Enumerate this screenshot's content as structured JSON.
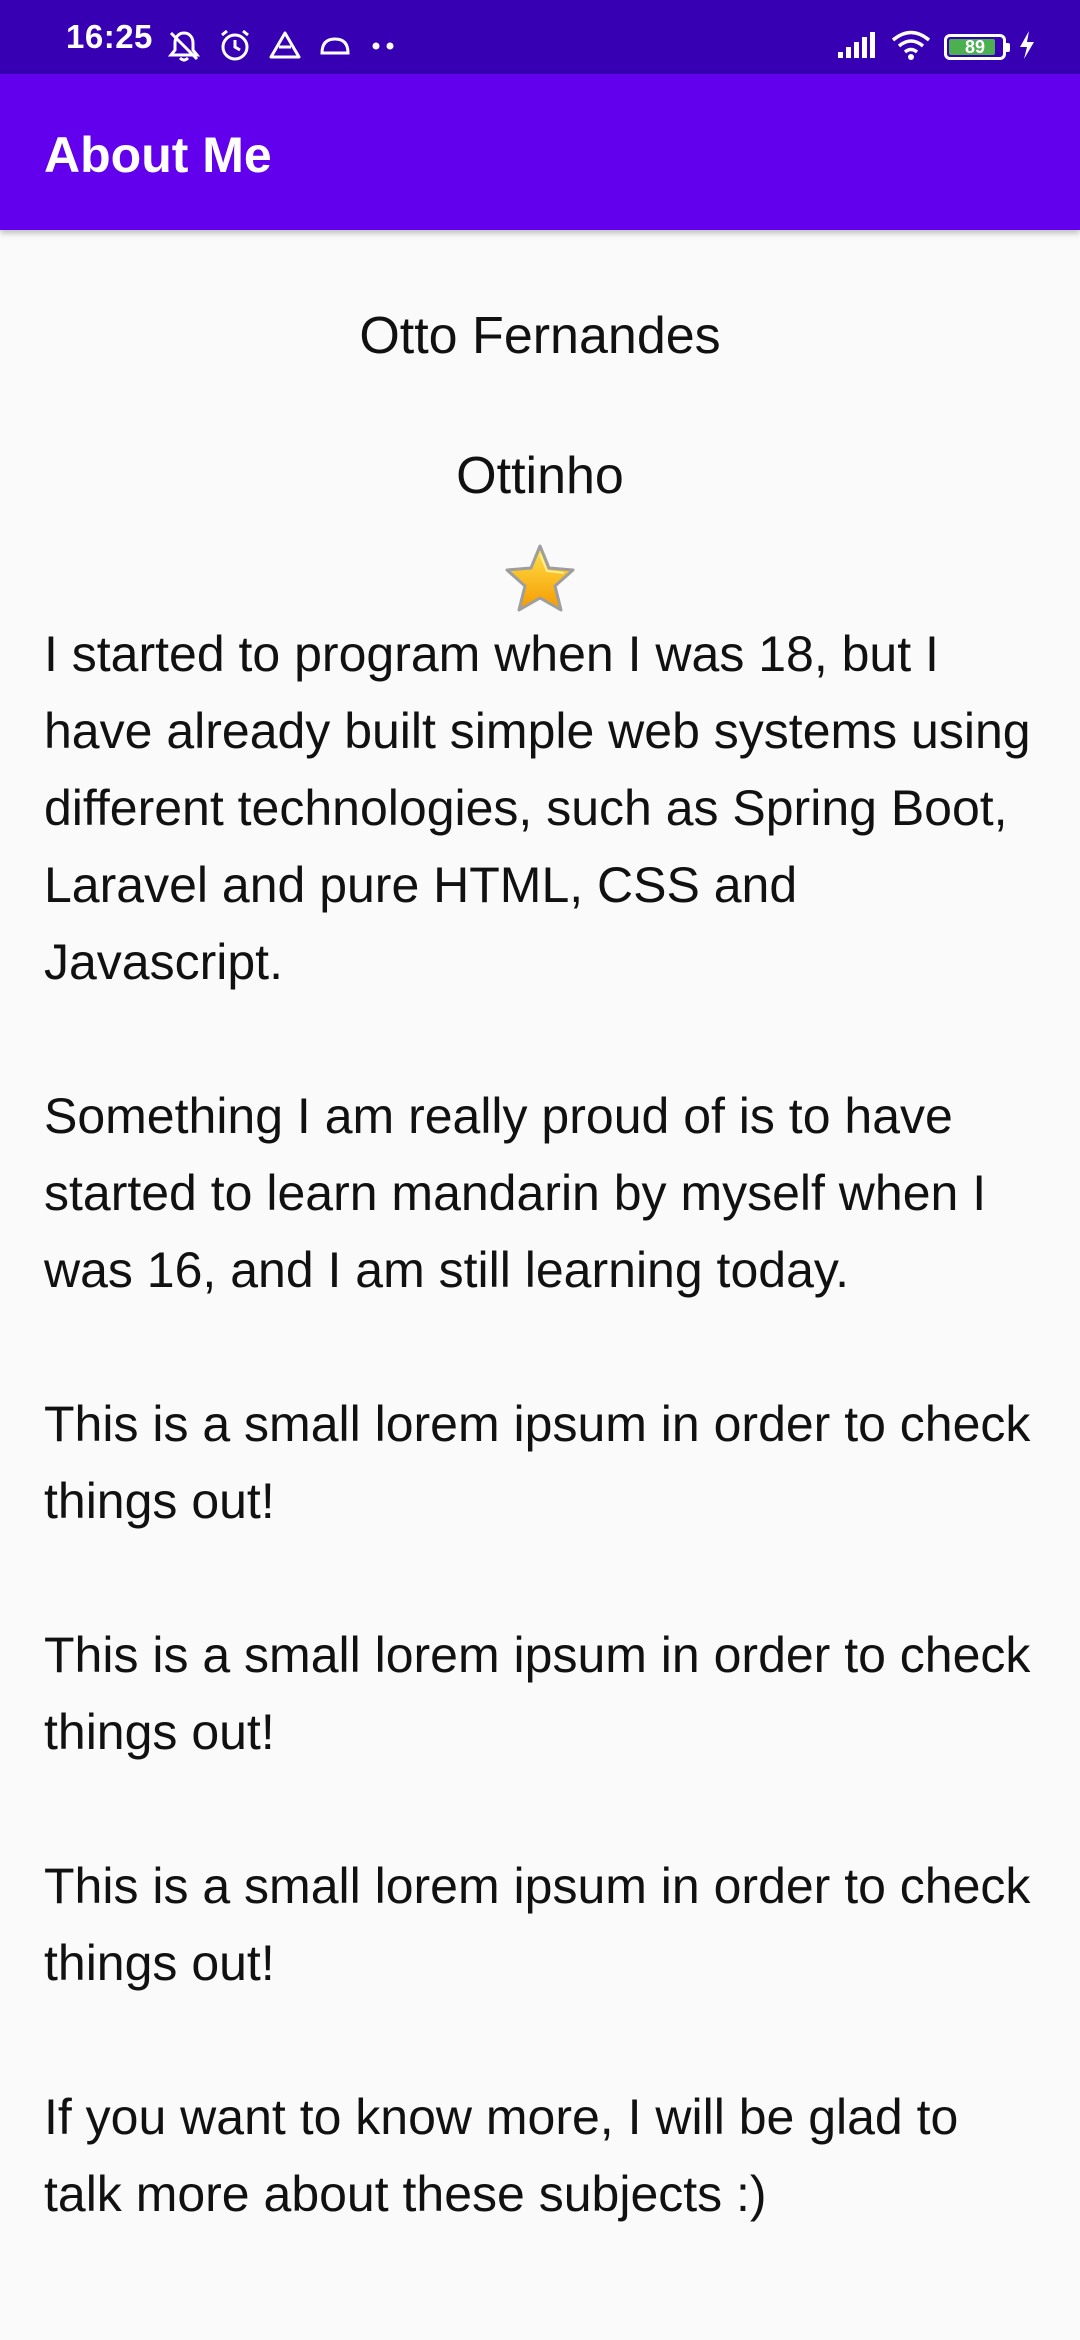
{
  "status_bar": {
    "time": "16:25",
    "battery_level": "89",
    "battery_fraction": 0.89,
    "icons": [
      "mute-icon",
      "alarm-icon",
      "drive-icon",
      "cloud-icon",
      "more-dots-icon",
      "signal-icon",
      "wifi-icon",
      "battery-icon",
      "charging-icon"
    ]
  },
  "app_bar": {
    "title": "About Me"
  },
  "profile": {
    "name": "Otto Fernandes",
    "nickname": "Ottinho",
    "star_icon": "star-icon"
  },
  "bio": {
    "paragraphs": [
      "I started to program when I was 18, but I have already built simple web systems using different technologies, such as Spring Boot, Laravel and pure HTML, CSS and Javascript.",
      "Something I am really proud of is to have started to learn mandarin by myself when I was 16, and I am still learning today.",
      "This is a small lorem ipsum in order to check things out!",
      "This is a small lorem ipsum in order to check things out!",
      "This is a small lorem ipsum in order to check things out!",
      "If you want to know more, I will be glad to talk more about these subjects :)"
    ]
  },
  "colors": {
    "status_bar": "#3700B3",
    "app_bar": "#6200EE",
    "background": "#FAFAFA",
    "text": "#111111"
  }
}
